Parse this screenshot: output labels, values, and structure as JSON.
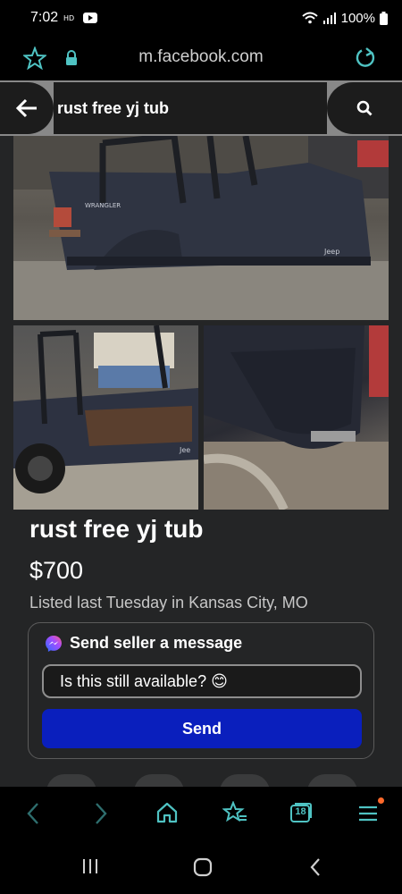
{
  "status_bar": {
    "time": "7:02",
    "battery": "100%"
  },
  "browser": {
    "url": "m.facebook.com",
    "tab_count": "18"
  },
  "search": {
    "query": "rust free yj tub"
  },
  "listing": {
    "title": "rust free yj tub",
    "price": "$700",
    "listed": "Listed last Tuesday in Kansas City, MO",
    "photo_text": [
      "WRANGLER",
      "Jeep",
      "Jee"
    ]
  },
  "message": {
    "heading": "Send seller a message",
    "input_value": "Is this still available? 😊",
    "send_label": "Send"
  },
  "colors": {
    "accent_teal": "#4fc3c3",
    "send_blue": "#0a1fbd",
    "notification_dot": "#ff6a2b"
  }
}
